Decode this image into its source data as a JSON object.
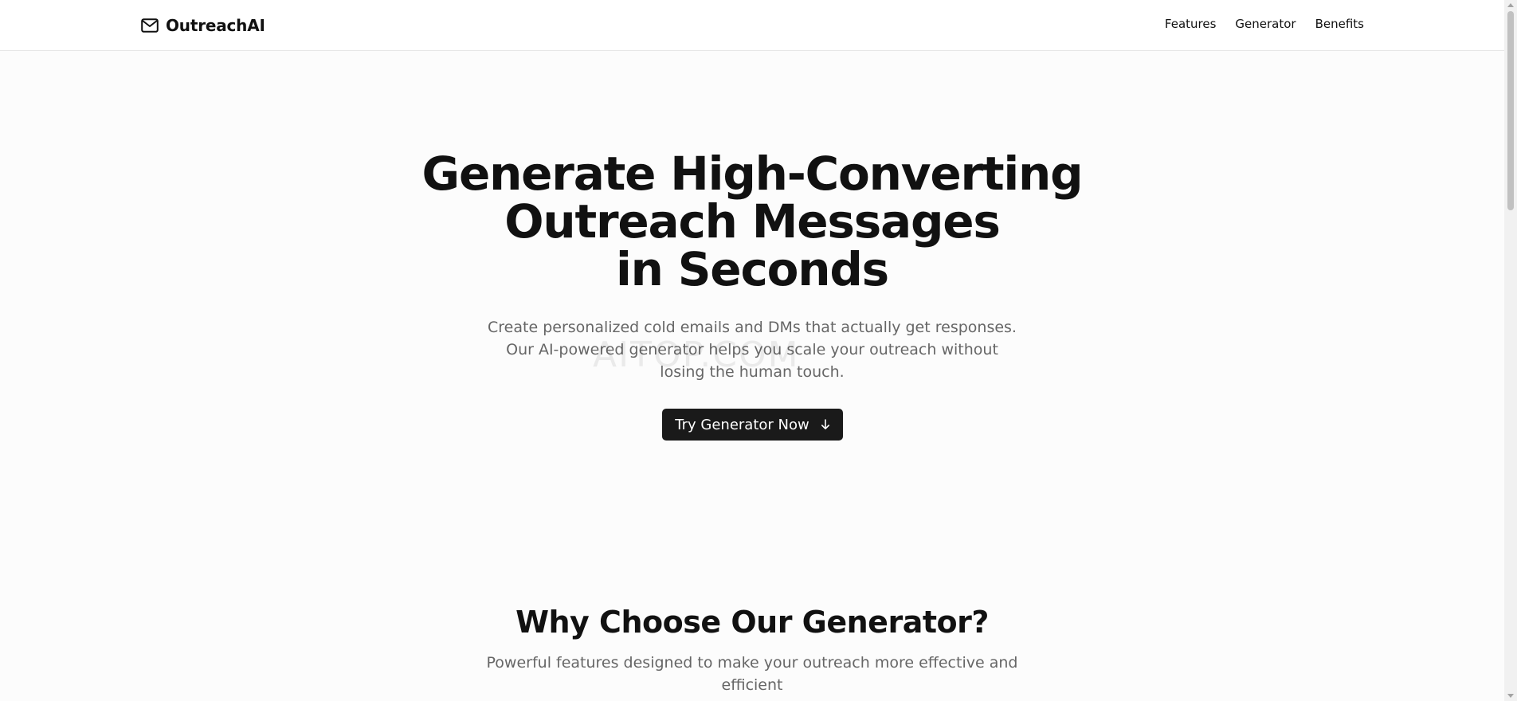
{
  "header": {
    "brand": "OutreachAI",
    "brand_icon": "mail-icon",
    "nav": [
      {
        "label": "Features"
      },
      {
        "label": "Generator"
      },
      {
        "label": "Benefits"
      }
    ]
  },
  "hero": {
    "title_lines": [
      "Generate High-Converting",
      "Outreach Messages",
      "in Seconds"
    ],
    "subtitle_lines": [
      "Create personalized cold emails and DMs that actually get responses.",
      "Our AI-powered generator helps you scale your outreach without",
      "losing the human touch."
    ],
    "cta_label": "Try Generator Now",
    "cta_icon": "arrow-down-icon"
  },
  "watermark": "AITOP.COM",
  "features": {
    "title": "Why Choose Our Generator?",
    "subtitle_lines": [
      "Powerful features designed to make your outreach more effective and",
      "efficient"
    ]
  },
  "colors": {
    "background": "#fcfcfc",
    "text": "#111111",
    "muted": "#666666",
    "button": "#1a1a1a"
  }
}
